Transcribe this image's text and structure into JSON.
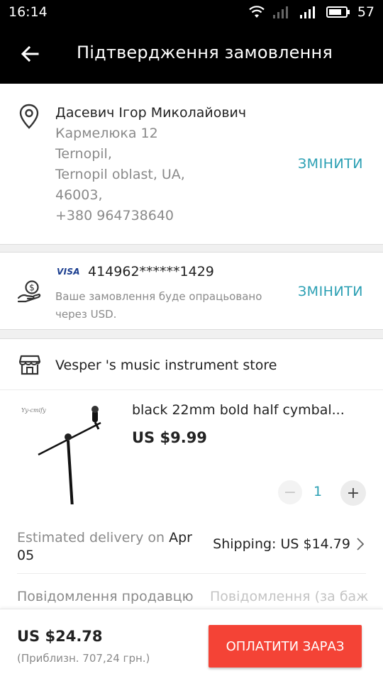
{
  "status_bar": {
    "time": "16:14",
    "battery": "57",
    "icons": [
      "wifi-icon",
      "signal-icon",
      "signal-icon",
      "battery-icon"
    ]
  },
  "header": {
    "title": "Підтвердження замовлення",
    "back_icon": "arrow-left-icon"
  },
  "address": {
    "name": "Дасевич Ігор Миколайович",
    "lines": [
      "Кармелюка 12",
      "Ternopil,",
      "Ternopil oblast, UA,",
      "46003,",
      "+380 964738640"
    ],
    "change_label": "ЗМІНИТИ",
    "icon": "location-pin-icon"
  },
  "payment": {
    "card_brand": "VISA",
    "card_number": "414962******1429",
    "note": "Ваше замовлення буде опрацьовано через USD.",
    "change_label": "ЗМІНИТИ",
    "icon": "hand-coin-icon"
  },
  "store": {
    "name": "Vesper 's music instrument store",
    "icon": "store-icon"
  },
  "item": {
    "title": "black 22mm bold half cymbal...",
    "price": "US $9.99",
    "image_caption": "Yy-cmify",
    "quantity": "1",
    "minus": "−",
    "plus": "+"
  },
  "delivery": {
    "prefix": "Estimated delivery on",
    "date": "Apr 05"
  },
  "shipping": {
    "label": "Shipping: US $14.79"
  },
  "message": {
    "label": "Повідомлення продавцю",
    "placeholder": "Повідомлення (за баж"
  },
  "footer": {
    "total": "US $24.78",
    "approx": "(Приблизн. 707,24 грн.)",
    "pay_button": "ОПЛАТИТИ ЗАРАЗ"
  },
  "colors": {
    "accent": "#2a9fb3",
    "pay_button": "#f44336",
    "header": "#000000"
  }
}
